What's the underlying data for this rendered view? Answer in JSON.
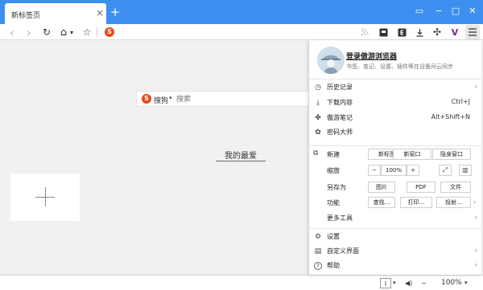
{
  "tab": {
    "title": "新标签页",
    "close": "×"
  },
  "new_tab": "+",
  "window": {
    "skin": "▭",
    "minimize": "−",
    "maximize": "□",
    "close": "✕"
  },
  "toolbar": {
    "back": "‹",
    "forward": "›",
    "reload": "↻",
    "home": "⌂",
    "home_caret": "▾",
    "favorite": "☆",
    "search_badge": "S",
    "ext_puzzle": "✣",
    "ext_v": "V"
  },
  "search": {
    "engine_badge": "S",
    "engine": "搜狗",
    "caret": "▾",
    "placeholder": "搜索"
  },
  "favorites": {
    "title": "我的最爱"
  },
  "menu": {
    "login_title": "登录傲游浏览器",
    "login_subtitle": "书签、笔记、设置、插件等在设备间云同步",
    "items_top": [
      {
        "label": "历史记录",
        "shortcut": "",
        "arrow": "›",
        "icon": "clock-icon",
        "glyph": "◷"
      },
      {
        "label": "下载内容",
        "shortcut": "Ctrl+J",
        "arrow": "",
        "icon": "download-icon",
        "glyph": "⤓"
      },
      {
        "label": "傲游笔记",
        "shortcut": "Alt+Shift+N",
        "arrow": "",
        "icon": "notes-icon",
        "glyph": "✤"
      },
      {
        "label": "密码大师",
        "shortcut": "",
        "arrow": "",
        "icon": "password-icon",
        "glyph": "✿"
      }
    ],
    "new": {
      "label": "新建",
      "tab": "新标签",
      "window": "新窗口",
      "private": "隐身窗口",
      "icon_glyph": "⧉"
    },
    "zoom": {
      "label": "缩放",
      "minus": "−",
      "value": "100%",
      "plus": "+",
      "fullscreen": "⤢",
      "reader": "▥"
    },
    "saveas": {
      "label": "另存为",
      "image": "图片",
      "pdf": "PDF",
      "file": "文件"
    },
    "functions": {
      "label": "功能",
      "find": "查找...",
      "print": "打印...",
      "cast": "投射...",
      "arrow": "›"
    },
    "more_tools": {
      "label": "更多工具",
      "arrow": "›"
    },
    "items_bottom": [
      {
        "label": "设置",
        "arrow": "",
        "icon": "gear-icon",
        "glyph": "⚙"
      },
      {
        "label": "自定义界面",
        "arrow": "›",
        "icon": "layout-icon",
        "glyph": "▤"
      },
      {
        "label": "帮助",
        "arrow": "›",
        "icon": "help-icon",
        "glyph": "?"
      }
    ]
  },
  "status": {
    "zoom": "100%",
    "speed_caret": "▾",
    "volume": "◀)",
    "zoom_caret": "▾",
    "dots": "···"
  }
}
